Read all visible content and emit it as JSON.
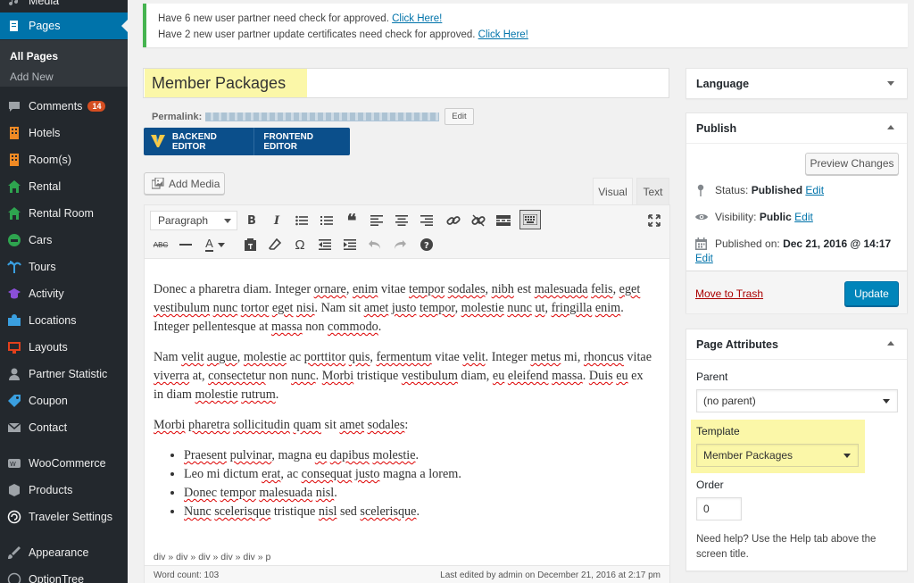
{
  "sidebar": {
    "items": [
      {
        "label": "Media",
        "icon": "media-icon"
      },
      {
        "label": "Pages",
        "icon": "pages-icon"
      },
      {
        "label": "Comments",
        "icon": "comments-icon",
        "badge": "14"
      },
      {
        "label": "Hotels",
        "icon": "hotels-icon"
      },
      {
        "label": "Room(s)",
        "icon": "rooms-icon"
      },
      {
        "label": "Rental",
        "icon": "rental-icon"
      },
      {
        "label": "Rental Room",
        "icon": "rental-room-icon"
      },
      {
        "label": "Cars",
        "icon": "cars-icon"
      },
      {
        "label": "Tours",
        "icon": "tours-icon"
      },
      {
        "label": "Activity",
        "icon": "activity-icon"
      },
      {
        "label": "Locations",
        "icon": "locations-icon"
      },
      {
        "label": "Layouts",
        "icon": "layouts-icon"
      },
      {
        "label": "Partner Statistic",
        "icon": "partner-statistic-icon"
      },
      {
        "label": "Coupon",
        "icon": "coupon-icon"
      },
      {
        "label": "Contact",
        "icon": "contact-icon"
      },
      {
        "label": "WooCommerce",
        "icon": "woocommerce-icon"
      },
      {
        "label": "Products",
        "icon": "products-icon"
      },
      {
        "label": "Traveler Settings",
        "icon": "traveler-settings-icon"
      },
      {
        "label": "Appearance",
        "icon": "appearance-icon"
      },
      {
        "label": "OptionTree",
        "icon": "optiontree-icon"
      }
    ],
    "submenu": {
      "all_pages": "All Pages",
      "add_new": "Add New"
    },
    "colors": {
      "bg": "#23282d",
      "active": "#0073aa",
      "badge": "#d54e21"
    }
  },
  "notice": {
    "line1": "Have 6 new user partner need check for approved.",
    "line2": "Have 2 new user partner update certificates need check for approved.",
    "link": "Click Here!"
  },
  "editor": {
    "title": "Member Packages",
    "permalink_label": "Permalink:",
    "edit_label": "Edit",
    "backend_editor": "BACKEND EDITOR",
    "frontend_editor": "FRONTEND EDITOR",
    "add_media": "Add Media",
    "tab_visual": "Visual",
    "tab_text": "Text",
    "format_select": "Paragraph",
    "path": "div » div » div » div » div » p",
    "word_count": "Word count: 103",
    "last_edited": "Last edited by admin on December 21, 2016 at 2:17 pm"
  },
  "language_box": {
    "title": "Language"
  },
  "publish": {
    "title": "Publish",
    "preview": "Preview Changes",
    "status_label": "Status:",
    "status_value": "Published",
    "visibility_label": "Visibility:",
    "visibility_value": "Public",
    "published_label": "Published on:",
    "published_value": "Dec 21, 2016 @ 14:17",
    "edit": "Edit",
    "trash": "Move to Trash",
    "update": "Update"
  },
  "page_attributes": {
    "title": "Page Attributes",
    "parent_label": "Parent",
    "parent_value": "(no parent)",
    "template_label": "Template",
    "template_value": "Member Packages",
    "order_label": "Order",
    "order_value": "0",
    "help": "Need help? Use the Help tab above the screen title."
  }
}
